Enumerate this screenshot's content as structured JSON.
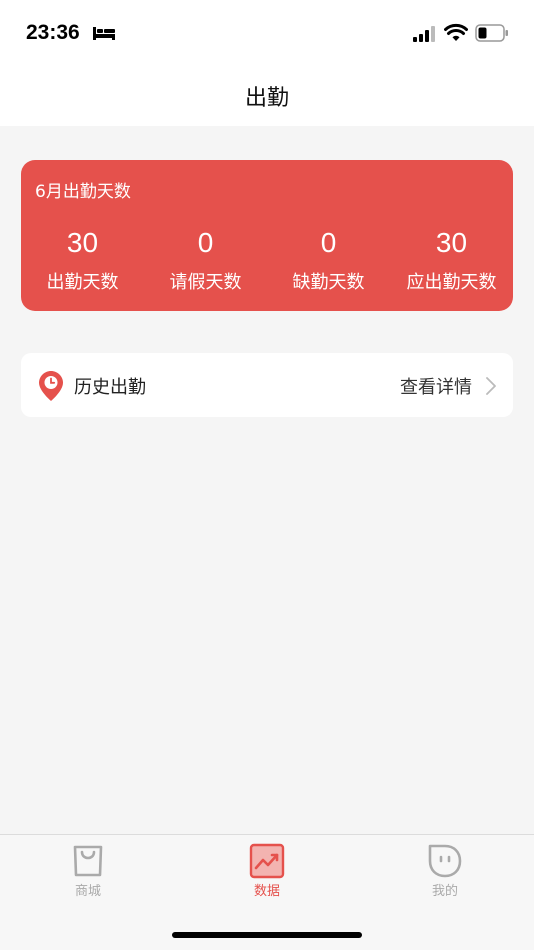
{
  "status_bar": {
    "time": "23:36"
  },
  "nav": {
    "title": "出勤"
  },
  "summary": {
    "title": "6月出勤天数",
    "accent_color": "#e5514c",
    "stats": [
      {
        "value": "30",
        "label": "出勤天数"
      },
      {
        "value": "0",
        "label": "请假天数"
      },
      {
        "value": "0",
        "label": "缺勤天数"
      },
      {
        "value": "30",
        "label": "应出勤天数"
      }
    ]
  },
  "history": {
    "icon": "location-clock-icon",
    "label": "历史出勤",
    "link_label": "查看详情"
  },
  "tab_bar": {
    "tabs": [
      {
        "label": "商城",
        "icon": "shopping-bag-icon",
        "active": false
      },
      {
        "label": "数据",
        "icon": "trend-chart-icon",
        "active": true
      },
      {
        "label": "我的",
        "icon": "face-icon",
        "active": false
      }
    ]
  }
}
